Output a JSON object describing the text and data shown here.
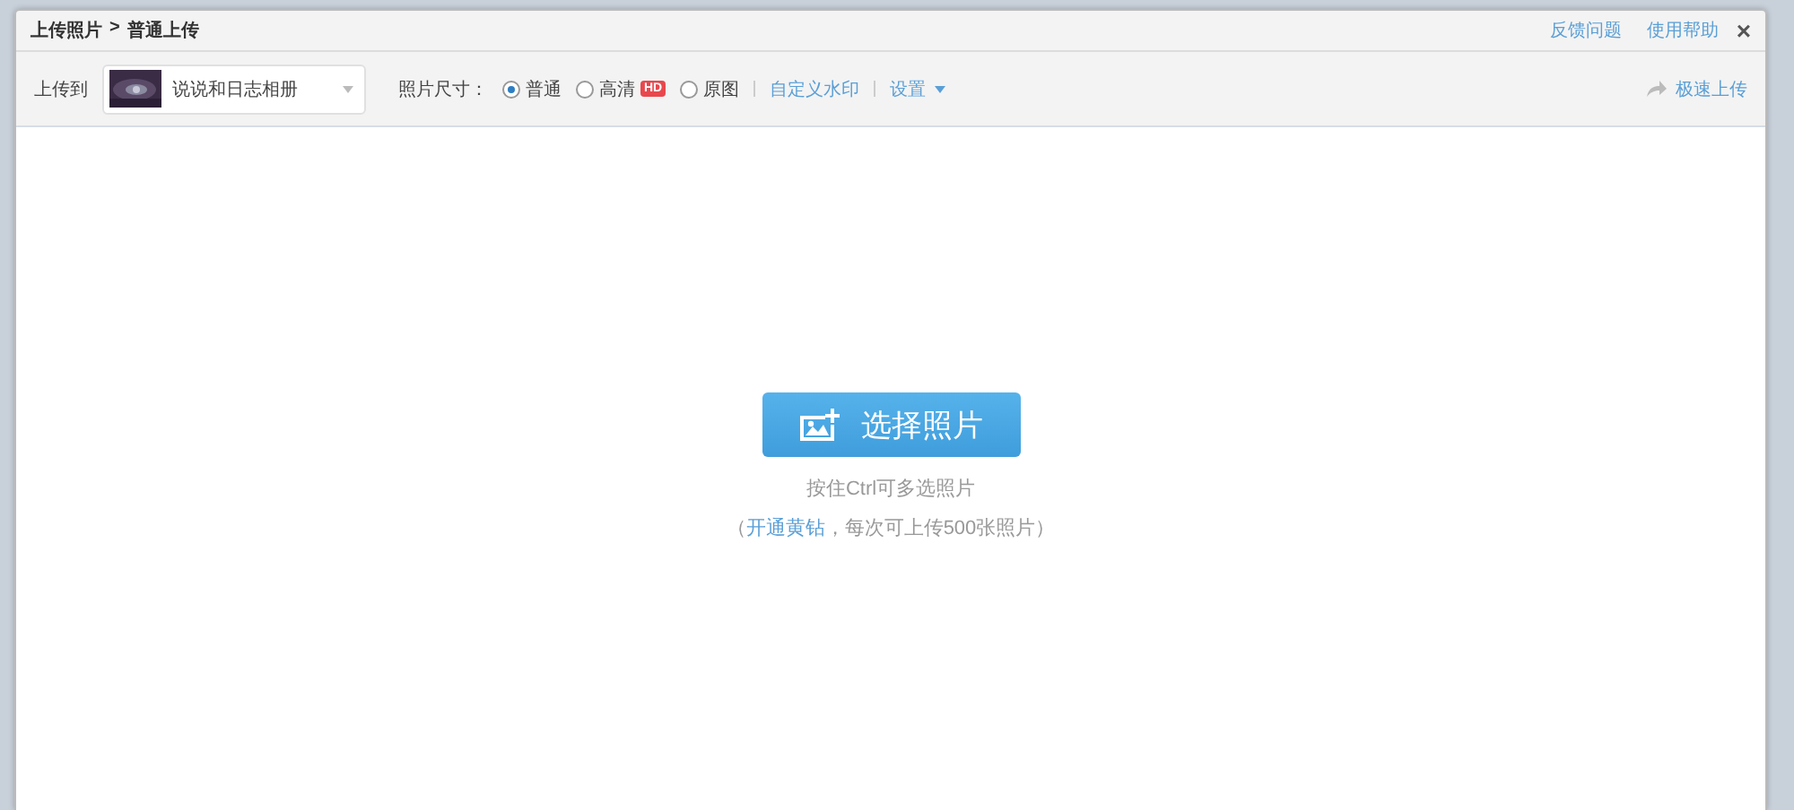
{
  "window": {
    "breadcrumb": [
      "上传照片",
      "普通上传"
    ],
    "separator": ">",
    "links": [
      "反馈问题",
      "使用帮助"
    ],
    "close": "×"
  },
  "toolbar": {
    "upload_to_label": "上传到",
    "album": {
      "name": "说说和日志相册",
      "kind": "picture"
    },
    "size_label": "照片尺寸：",
    "size_options": [
      {
        "label": "普通",
        "selected": true
      },
      {
        "label": "高清",
        "selected": false,
        "badge": "HD"
      },
      {
        "label": "原图",
        "selected": false
      }
    ],
    "watermark_link": "自定义水印",
    "settings_link": "设置",
    "fast_upload": "极速上传"
  },
  "upload": {
    "button": "选择照片",
    "hint": "按住Ctrl可多选照片",
    "note_before": "（",
    "note_link": "开通黄钻",
    "note_after": "，每次可上传500张照片）"
  }
}
